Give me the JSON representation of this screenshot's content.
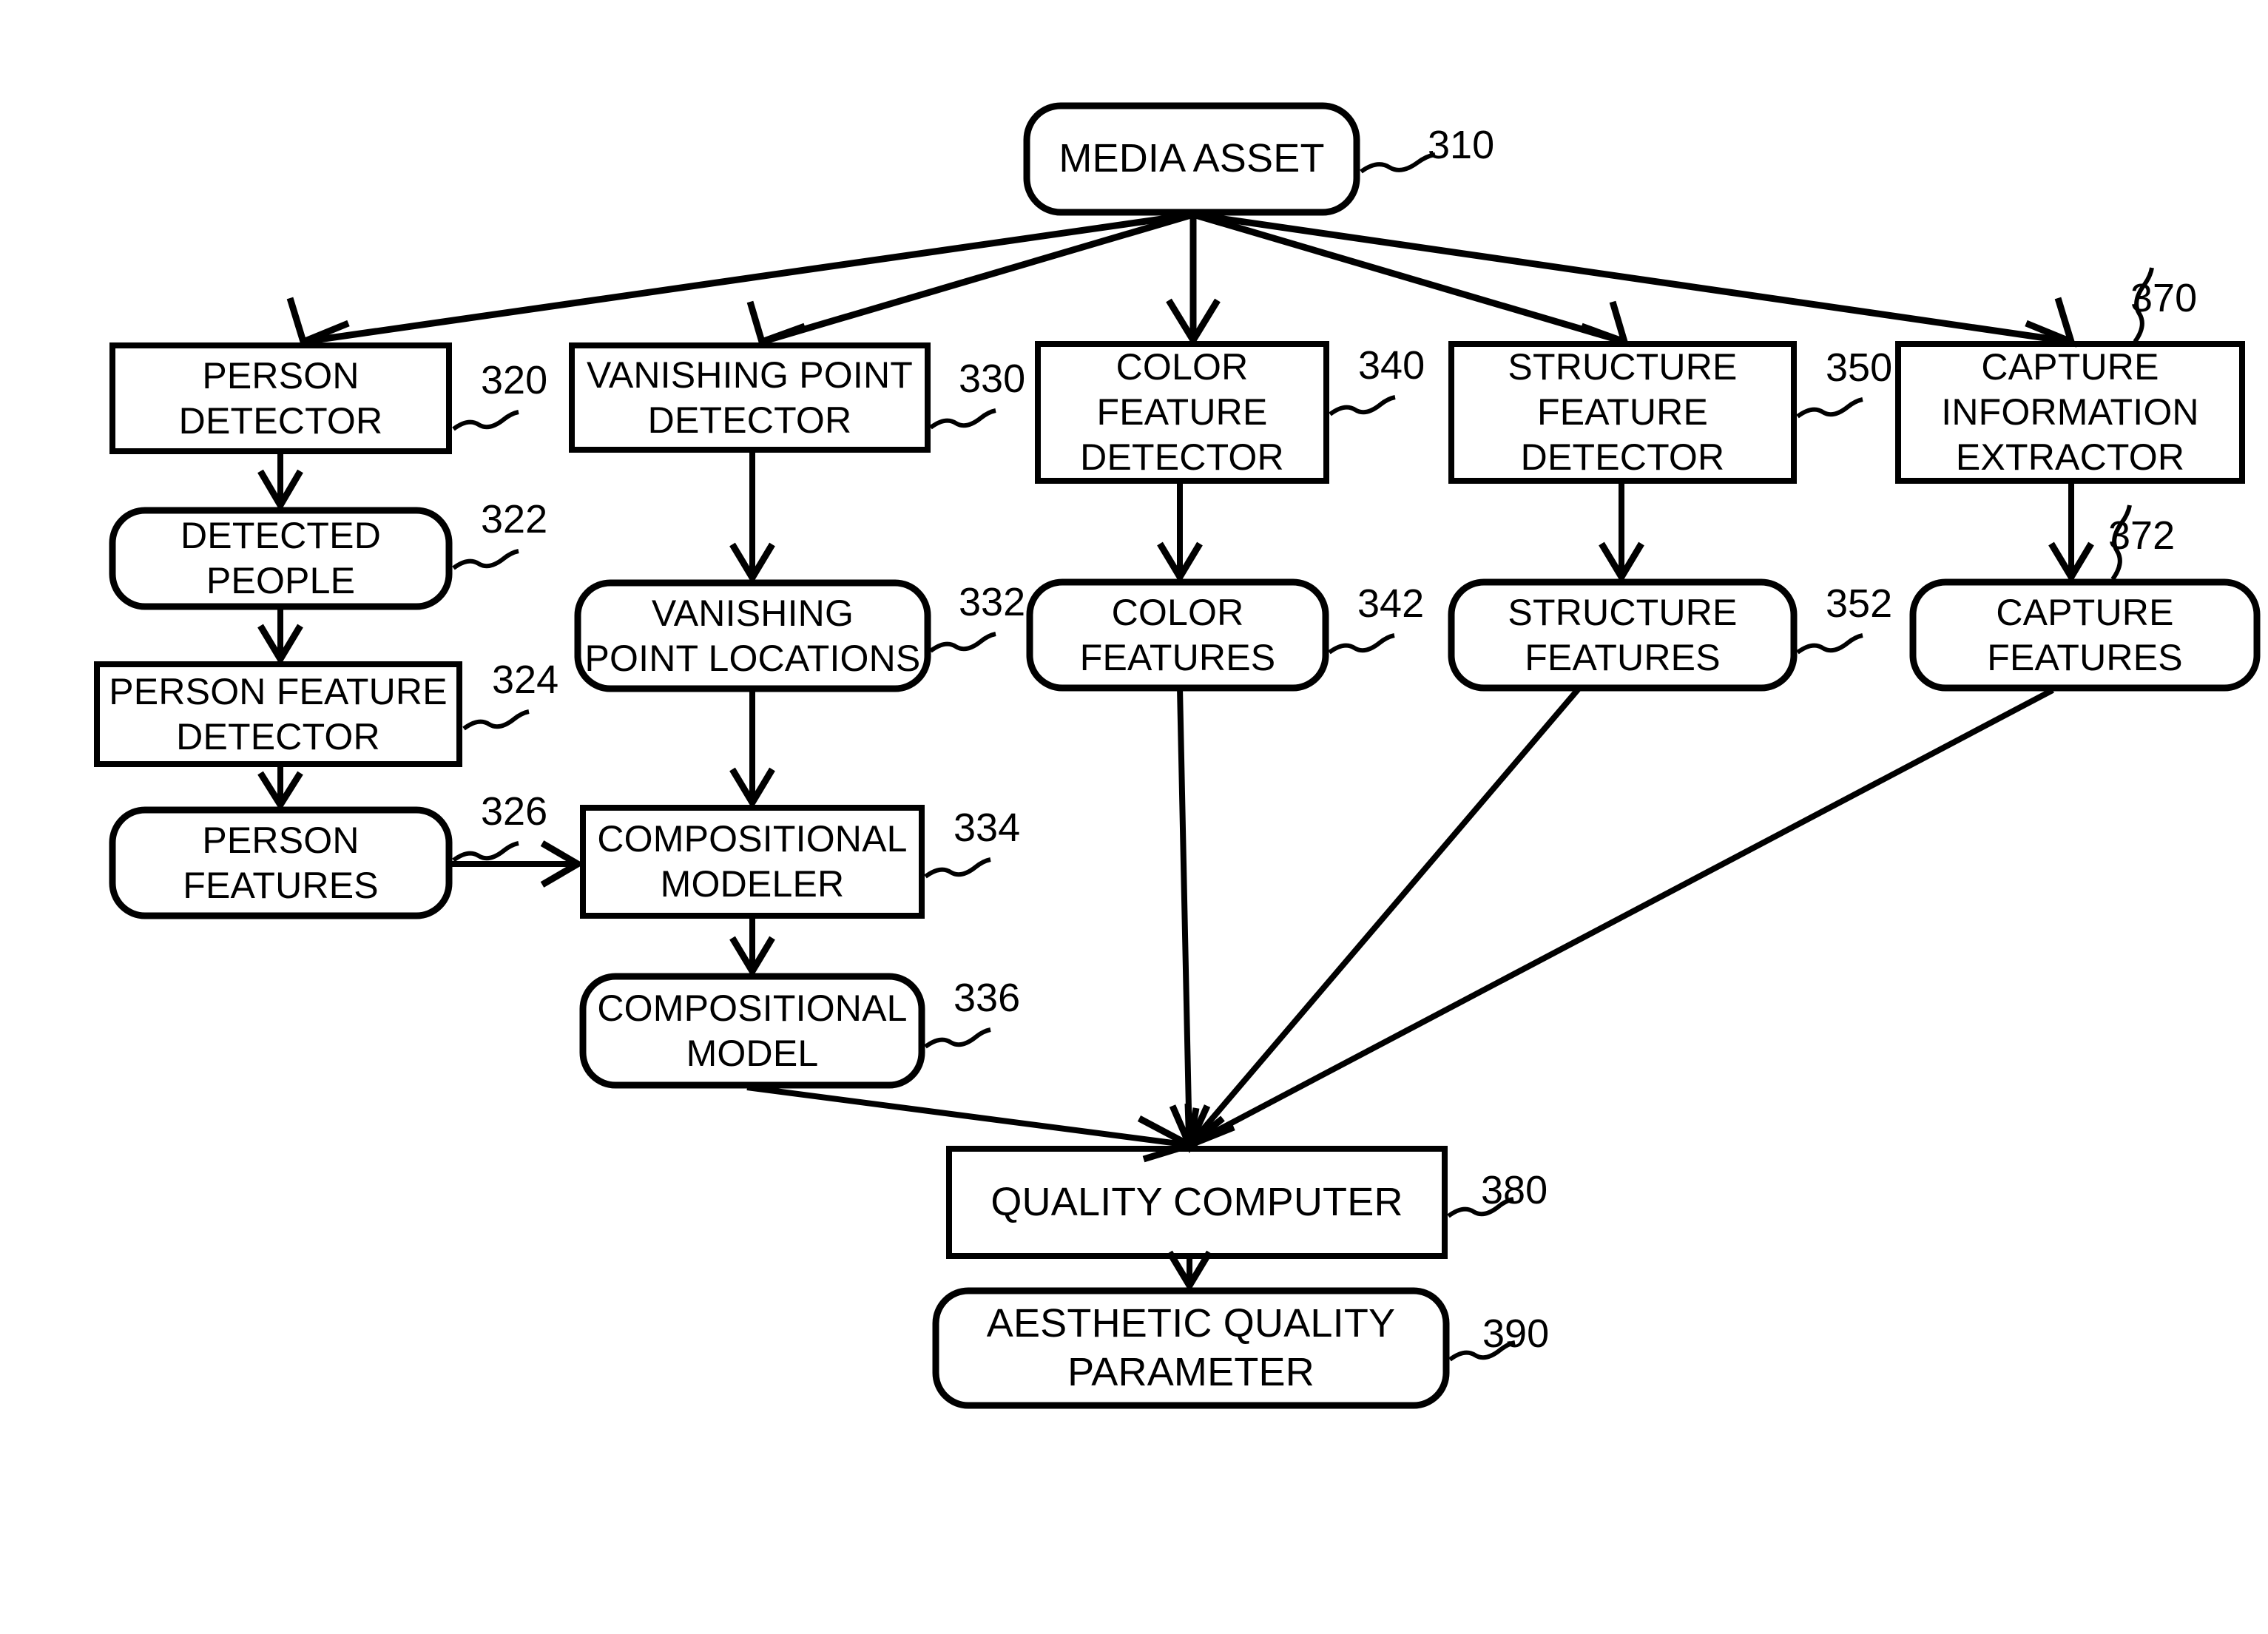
{
  "diagram": {
    "title": "Aesthetic quality computation flow diagram",
    "stroke_color": "#000000",
    "background_color": "#ffffff",
    "nodes": [
      {
        "id": "media_asset",
        "label": "MEDIA ASSET",
        "ref": "310",
        "shape": "rounded"
      },
      {
        "id": "person_det",
        "label": "PERSON\nDETECTOR",
        "ref": "320",
        "shape": "rect"
      },
      {
        "id": "detected_people",
        "label": "DETECTED\nPEOPLE",
        "ref": "322",
        "shape": "rounded"
      },
      {
        "id": "person_feat_det",
        "label": "PERSON  FEATURE\nDETECTOR",
        "ref": "324",
        "shape": "rect"
      },
      {
        "id": "person_feat",
        "label": "PERSON\nFEATURES",
        "ref": "326",
        "shape": "rounded"
      },
      {
        "id": "vp_det",
        "label": "VANISHING POINT\nDETECTOR",
        "ref": "330",
        "shape": "rect"
      },
      {
        "id": "vp_loc",
        "label": "VANISHING\nPOINT LOCATIONS",
        "ref": "332",
        "shape": "rounded"
      },
      {
        "id": "comp_modeler",
        "label": "COMPOSITIONAL\nMODELER",
        "ref": "334",
        "shape": "rect"
      },
      {
        "id": "comp_model",
        "label": "COMPOSITIONAL\nMODEL",
        "ref": "336",
        "shape": "rounded"
      },
      {
        "id": "color_det",
        "label": "COLOR\nFEATURE\nDETECTOR",
        "ref": "340",
        "shape": "rect"
      },
      {
        "id": "color_feat",
        "label": "COLOR\nFEATURES",
        "ref": "342",
        "shape": "rounded"
      },
      {
        "id": "struct_det",
        "label": "STRUCTURE\nFEATURE\nDETECTOR",
        "ref": "350",
        "shape": "rect"
      },
      {
        "id": "struct_feat",
        "label": "STRUCTURE\nFEATURES",
        "ref": "352",
        "shape": "rounded"
      },
      {
        "id": "capture_ext",
        "label": "CAPTURE\nINFORMATION\nEXTRACTOR",
        "ref": "370",
        "shape": "rect"
      },
      {
        "id": "capture_feat",
        "label": "CAPTURE\nFEATURES",
        "ref": "372",
        "shape": "rounded"
      },
      {
        "id": "quality_comp",
        "label": "QUALITY COMPUTER",
        "ref": "380",
        "shape": "rect"
      },
      {
        "id": "aesthetic_param",
        "label": "AESTHETIC QUALITY\nPARAMETER",
        "ref": "390",
        "shape": "rounded"
      }
    ],
    "edges": [
      {
        "from": "media_asset",
        "to": "person_det"
      },
      {
        "from": "media_asset",
        "to": "vp_det"
      },
      {
        "from": "media_asset",
        "to": "color_det"
      },
      {
        "from": "media_asset",
        "to": "struct_det"
      },
      {
        "from": "media_asset",
        "to": "capture_ext"
      },
      {
        "from": "person_det",
        "to": "detected_people"
      },
      {
        "from": "detected_people",
        "to": "person_feat_det"
      },
      {
        "from": "person_feat_det",
        "to": "person_feat"
      },
      {
        "from": "person_feat",
        "to": "comp_modeler"
      },
      {
        "from": "vp_det",
        "to": "vp_loc"
      },
      {
        "from": "vp_loc",
        "to": "comp_modeler"
      },
      {
        "from": "comp_modeler",
        "to": "comp_model"
      },
      {
        "from": "comp_model",
        "to": "quality_comp"
      },
      {
        "from": "color_det",
        "to": "color_feat"
      },
      {
        "from": "color_feat",
        "to": "quality_comp"
      },
      {
        "from": "struct_det",
        "to": "struct_feat"
      },
      {
        "from": "struct_feat",
        "to": "quality_comp"
      },
      {
        "from": "capture_ext",
        "to": "capture_feat"
      },
      {
        "from": "capture_feat",
        "to": "quality_comp"
      },
      {
        "from": "quality_comp",
        "to": "aesthetic_param"
      }
    ]
  }
}
